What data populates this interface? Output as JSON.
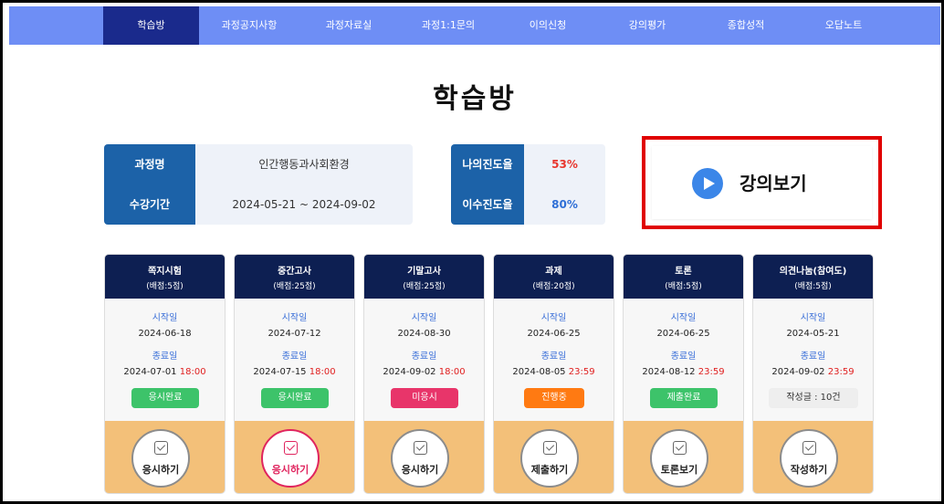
{
  "nav": [
    "학습방",
    "과정공지사항",
    "과정자료실",
    "과정1:1문의",
    "이의신청",
    "강의평가",
    "종합성적",
    "오답노트"
  ],
  "title": "학습방",
  "course_info": {
    "name_label": "과정명",
    "name_value": "인간행동과사회환경",
    "period_label": "수강기간",
    "period_value": "2024-05-21 ~ 2024-09-02"
  },
  "progress": {
    "my_label": "나의진도율",
    "my_value": "53%",
    "my_color": "#e8362e",
    "req_label": "이수진도율",
    "req_value": "80%",
    "req_color": "#2f6fd6"
  },
  "lecture_button": "강의보기",
  "cards": [
    {
      "name": "쪽지시험",
      "weight": "(배점:5점)",
      "start_label": "시작일",
      "start": "2024-06-18",
      "end_label": "종료일",
      "end_date": "2024-07-01",
      "end_time": "18:00",
      "status": "응시완료",
      "status_color": "#3dc36a",
      "action": "응시하기"
    },
    {
      "name": "중간고사",
      "weight": "(배점:25점)",
      "start_label": "시작일",
      "start": "2024-07-12",
      "end_label": "종료일",
      "end_date": "2024-07-15",
      "end_time": "18:00",
      "status": "응시완료",
      "status_color": "#3dc36a",
      "action": "응시하기"
    },
    {
      "name": "기말고사",
      "weight": "(배점:25점)",
      "start_label": "시작일",
      "start": "2024-08-30",
      "end_label": "종료일",
      "end_date": "2024-09-02",
      "end_time": "18:00",
      "status": "미응시",
      "status_color": "#e8356a",
      "action": "응시하기"
    },
    {
      "name": "과제",
      "weight": "(배점:20점)",
      "start_label": "시작일",
      "start": "2024-06-25",
      "end_label": "종료일",
      "end_date": "2024-08-05",
      "end_time": "23:59",
      "status": "진행중",
      "status_color": "#ff7a12",
      "action": "제출하기"
    },
    {
      "name": "토론",
      "weight": "(배점:5점)",
      "start_label": "시작일",
      "start": "2024-06-25",
      "end_label": "종료일",
      "end_date": "2024-08-12",
      "end_time": "23:59",
      "status": "제출완료",
      "status_color": "#3dc36a",
      "action": "토론보기"
    },
    {
      "name": "의견나눔(참여도)",
      "weight": "(배점:5점)",
      "start_label": "시작일",
      "start": "2024-05-21",
      "end_label": "종료일",
      "end_date": "2024-09-02",
      "end_time": "23:59",
      "status": "작성글 : 10건",
      "status_color": "#eeeeee",
      "action": "작성하기"
    }
  ]
}
